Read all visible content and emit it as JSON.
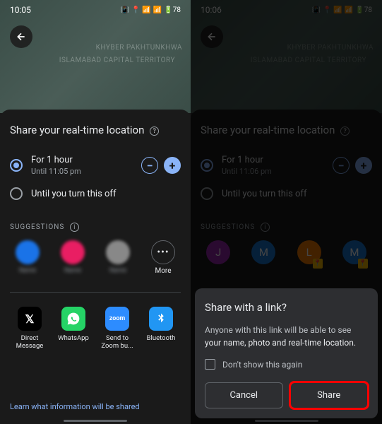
{
  "left": {
    "status": {
      "time": "10:05",
      "battery": "78"
    },
    "map": {
      "label1": "KHYBER PAKHTUNKHWA",
      "label2": "ISLAMABAD CAPITAL TERRITORY"
    },
    "sheet": {
      "title": "Share your real-time location",
      "option1": {
        "title": "For 1 hour",
        "sub": "Until 11:05 pm"
      },
      "option2": {
        "title": "Until you turn this off"
      }
    },
    "suggestions": {
      "header": "SUGGESTIONS",
      "more": "More"
    },
    "apps": {
      "direct": "Direct Message",
      "whatsapp": "WhatsApp",
      "zoom": "Send to Zoom bu...",
      "bluetooth": "Bluetooth"
    },
    "footer": "Learn what information will be shared"
  },
  "right": {
    "status": {
      "time": "10:06",
      "battery": "78"
    },
    "map": {
      "label1": "KHYBER PAKHTUNKHWA",
      "label2": "ISLAMABAD CAPITAL TERRITORY"
    },
    "sheet": {
      "title": "Share your real-time location",
      "option1": {
        "title": "For 1 hour",
        "sub": "Until 11:06 pm"
      },
      "option2": {
        "title": "Until you turn this off"
      }
    },
    "suggestions": {
      "header": "SUGGESTIONS",
      "contacts": [
        {
          "letter": "J",
          "color": "#9c27b0"
        },
        {
          "letter": "M",
          "color": "#1976d2"
        },
        {
          "letter": "L",
          "color": "#f57c00"
        },
        {
          "letter": "M",
          "color": "#1976d2"
        }
      ]
    },
    "dialog": {
      "title": "Share with a link?",
      "body_pre": "Anyone with this link will be able to see ",
      "body_bold": "your name, photo and real-time location.",
      "checkbox": "Don't show this again",
      "cancel": "Cancel",
      "share": "Share"
    }
  }
}
